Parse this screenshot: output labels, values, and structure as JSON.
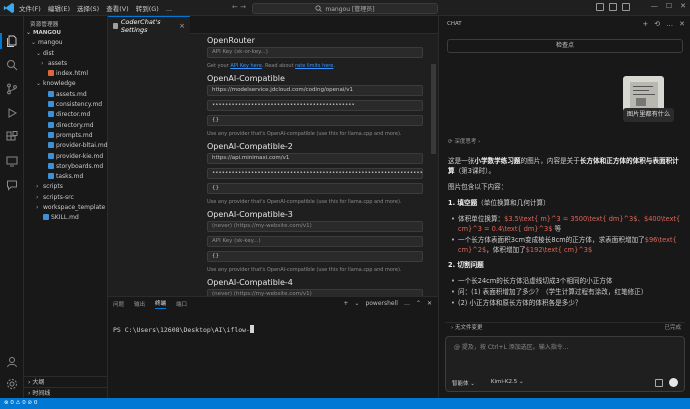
{
  "titlebar": {
    "menu": [
      "文件(F)",
      "编辑(E)",
      "选择(S)",
      "查看(V)",
      "转到(G)",
      "..."
    ],
    "search_text": "mangou [管理员]"
  },
  "explorer": {
    "header": "资源管理器",
    "root": "MANGOU",
    "rows": [
      {
        "label": "mangou",
        "indent": 1,
        "chevron": "⌄",
        "type": "folder"
      },
      {
        "label": "dist",
        "indent": 2,
        "chevron": "⌄",
        "type": "folder"
      },
      {
        "label": "assets",
        "indent": 3,
        "chevron": "›",
        "type": "folder"
      },
      {
        "label": "index.html",
        "indent": 3,
        "chevron": "",
        "type": "html"
      },
      {
        "label": "knowledge",
        "indent": 2,
        "chevron": "⌄",
        "type": "folder"
      },
      {
        "label": "assets.md",
        "indent": 3,
        "chevron": "",
        "type": "md"
      },
      {
        "label": "consistency.md",
        "indent": 3,
        "chevron": "",
        "type": "md"
      },
      {
        "label": "director.md",
        "indent": 3,
        "chevron": "",
        "type": "md"
      },
      {
        "label": "directory.md",
        "indent": 3,
        "chevron": "",
        "type": "md"
      },
      {
        "label": "prompts.md",
        "indent": 3,
        "chevron": "",
        "type": "md"
      },
      {
        "label": "provider-bltai.md",
        "indent": 3,
        "chevron": "",
        "type": "md"
      },
      {
        "label": "provider-kie.md",
        "indent": 3,
        "chevron": "",
        "type": "md"
      },
      {
        "label": "storyboards.md",
        "indent": 3,
        "chevron": "",
        "type": "md"
      },
      {
        "label": "tasks.md",
        "indent": 3,
        "chevron": "",
        "type": "md"
      },
      {
        "label": "scripts",
        "indent": 2,
        "chevron": "›",
        "type": "folder"
      },
      {
        "label": "scripts-src",
        "indent": 2,
        "chevron": "›",
        "type": "folder"
      },
      {
        "label": "workspace_template",
        "indent": 2,
        "chevron": "›",
        "type": "folder"
      },
      {
        "label": "SKILL.md",
        "indent": 2,
        "chevron": "",
        "type": "md"
      }
    ],
    "outline": "大纲",
    "timeline": "时间线"
  },
  "editor": {
    "tab_label": "CoderChat's Settings",
    "openrouter": {
      "title": "OpenRouter",
      "api_key_placeholder": "API Key (sk-or-key...)",
      "hint_pre": "Get your",
      "hint_link1": "API Key here",
      "hint_mid": ". Read about",
      "hint_link2": "rate limits here",
      "hint_post": "."
    },
    "providers": [
      {
        "title": "OpenAI-Compatible",
        "base_url": "https://modelservice.jdcloud.com/coding/openai/v1",
        "api_key": "••••••••••••••••••••••••••••••••••••••••••••",
        "models": "{}",
        "base_ph": false,
        "key_ph": false
      },
      {
        "title": "OpenAI-Compatible-2",
        "base_url": "https://api.minimaxi.com/v1",
        "api_key": "••••••••••••••••••••••••••••••••••••••••••••••••••••••••••••••••••••",
        "models": "{}",
        "base_ph": false,
        "key_ph": false
      },
      {
        "title": "OpenAI-Compatible-3",
        "base_url": "(never) (https://my-website.com/v1)",
        "api_key": "API Key (sk-key...)",
        "models": "{}",
        "base_ph": true,
        "key_ph": true
      },
      {
        "title": "OpenAI-Compatible-4",
        "base_url": "(never) (https://my-website.com/v1)",
        "api_key": "",
        "models": "",
        "base_ph": true,
        "key_ph": true
      }
    ],
    "compat_hint": "Use any provider that's OpenAI-compatible (use this for llama.cpp and more)."
  },
  "panel": {
    "tabs": [
      "问题",
      "输出",
      "终端",
      "端口"
    ],
    "active_tab": "终端",
    "shell_label": "powershell",
    "prompt": "PS C:\\Users\\12608\\Desktop\\AI\\iflow-"
  },
  "chat": {
    "header": "CHAT",
    "check_button": "检查点",
    "user_message": "图片里都有什么",
    "thinking": "深度思考",
    "intro": "这是一张小学数学练习题的图片，内容是关于长方体和正方体的体积与表面积计算（第3课时）。",
    "includes": "图片包含以下内容：",
    "s1_title": "1. 填空题",
    "s1_sub": "（单位换算和几何计算）",
    "s1_item1_pre": "体积单位换算：",
    "s1_item1_red": "$3.5\\text{ m}^3 = 3500\\text{ dm}^3$、$400\\text{ cm}^3 = 0.4\\text{ dm}^3$",
    "s1_item1_post": " 等",
    "s1_item2_pre": "一个长方体表面积3cm变成棱长8cm的正方体，求表面积增加了",
    "s1_item2_red": "$96\\text{ cm}^2$",
    "s1_item2_mid": "，体积增加了",
    "s1_item2_red2": "$192\\text{ cm}^3$",
    "s2_title": "2. 切割问题",
    "s2_item1": "一个长24cm的长方体沿虚线切成3个相同的小正方体",
    "s2_item2": "问：(1) 表面积增加了多少？（学生计算过程有涂改，红笔修正）",
    "s2_item3": "(2) 小正方体和原长方体的体积各是多少？",
    "changes_label": "无文件变更",
    "changes_right": "已完成",
    "input_placeholder": "@ 提及，按 Ctrl+L 添加选区。输入指令...",
    "mode_label": "智能体",
    "model_label": "Kimi-K2.5"
  },
  "statusbar": {
    "text": "⊗ 0 ⚠ 0   ⊘ 0"
  },
  "colors": {
    "accent": "#0078d4",
    "bg": "#1f1f1f",
    "sidebar": "#181818",
    "red_text": "#e0665a"
  }
}
